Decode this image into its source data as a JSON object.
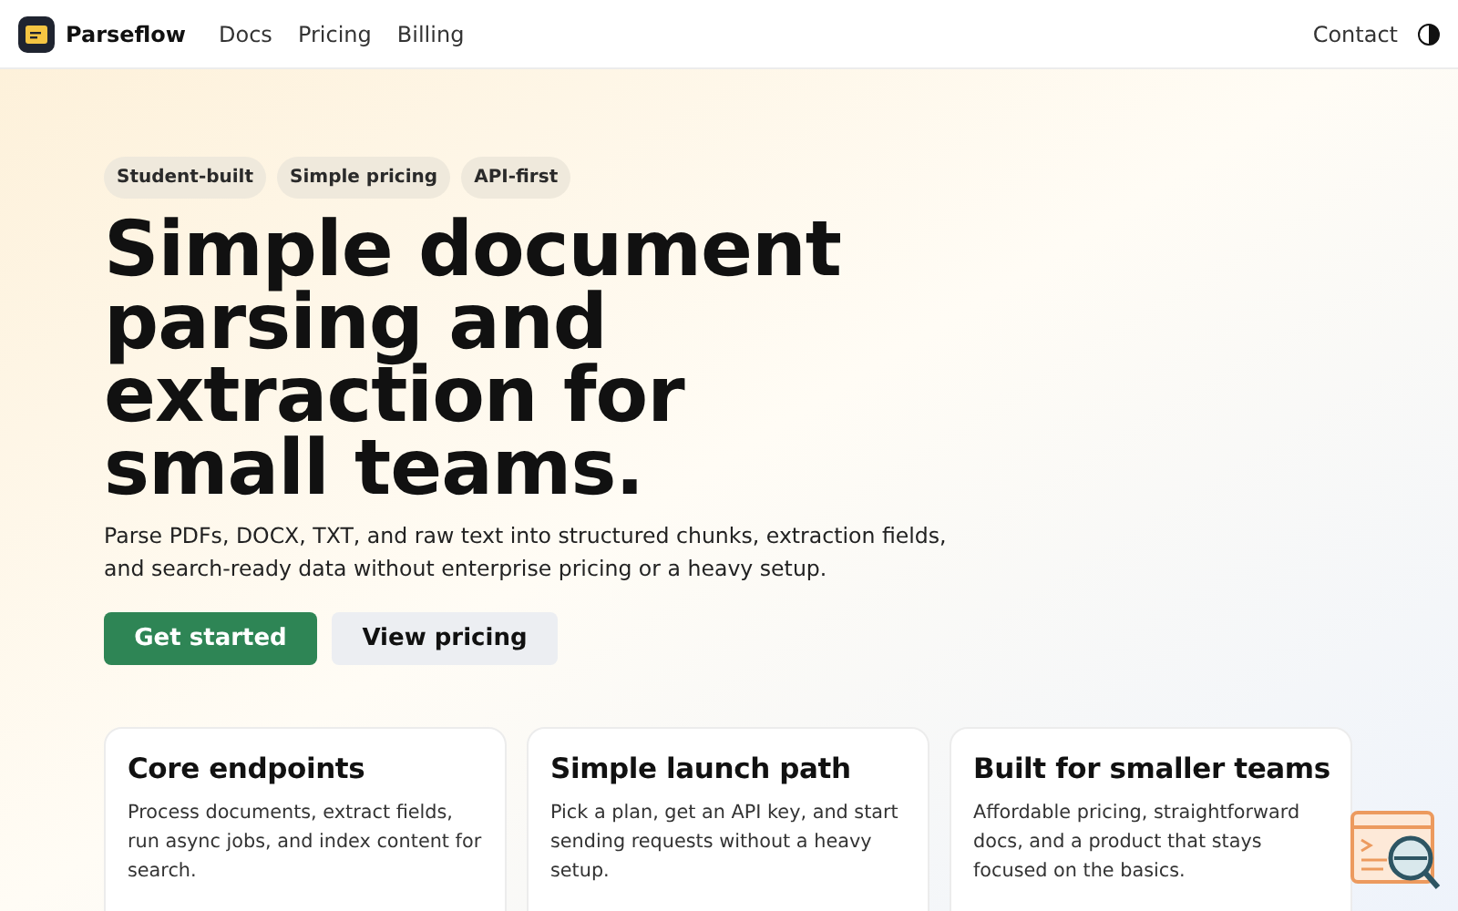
{
  "nav": {
    "brand": "Parseflow",
    "links": [
      "Docs",
      "Pricing",
      "Billing"
    ],
    "contact": "Contact"
  },
  "hero": {
    "tags": [
      "Student-built",
      "Simple pricing",
      "API-first"
    ],
    "title": "Simple document parsing and extraction for small teams.",
    "lead": "Parse PDFs, DOCX, TXT, and raw text into structured chunks, extraction fields, and search-ready data without enterprise pricing or a heavy setup.",
    "buttons": [
      {
        "label": "Get started",
        "kind": "primary"
      },
      {
        "label": "View pricing",
        "kind": "secondary"
      }
    ]
  },
  "cards": [
    {
      "title": "Core endpoints",
      "text": "Process documents, extract fields, run async jobs, and index content for search."
    },
    {
      "title": "Simple launch path",
      "text": "Pick a plan, get an API key, and start sending requests without a heavy setup."
    },
    {
      "title": "Built for smaller teams",
      "text": "Affordable pricing, straightforward docs, and a product that stays focused on the basics."
    }
  ]
}
